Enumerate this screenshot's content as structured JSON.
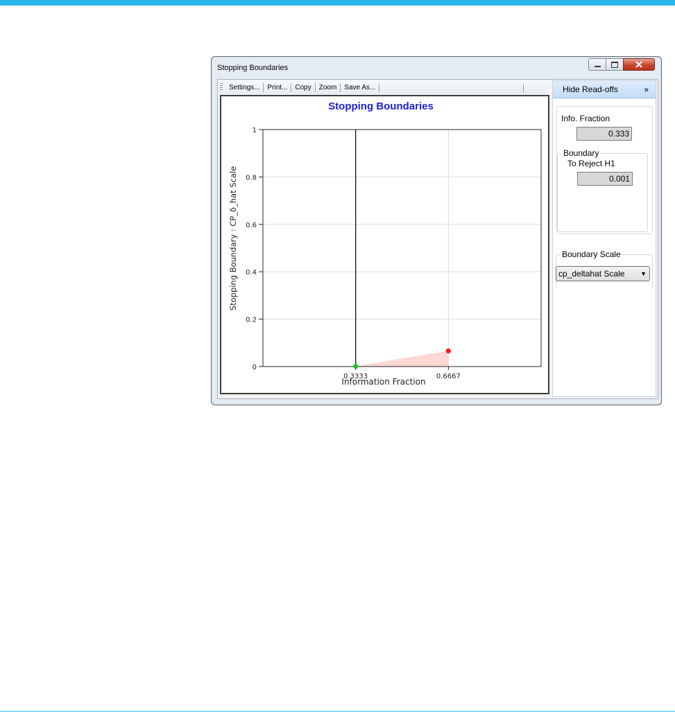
{
  "window": {
    "title": "Stopping Boundaries",
    "controls": {
      "minimize": "–",
      "maximize": "▫",
      "close": "✕"
    }
  },
  "toolbar": {
    "items": [
      "Settings...",
      "Print...",
      "Copy",
      "Zoom",
      "Save As..."
    ]
  },
  "readoffs": {
    "hide_label": "Hide Read-offs",
    "hide_chevron": "»",
    "info_fraction_label": "Info. Fraction",
    "info_fraction_value": "0.333",
    "boundary_group_label": "Boundary",
    "to_reject_label": "To Reject H1",
    "to_reject_value": "0.001",
    "boundary_scale_label": "Boundary Scale",
    "boundary_scale_selected": "cp_deltahat Scale"
  },
  "chart_data": {
    "type": "line",
    "title": "Stopping Boundaries",
    "xlabel": "Information Fraction",
    "ylabel": "Stopping Boundary : CP_δ_hat Scale",
    "xlim": [
      0,
      1
    ],
    "ylim": [
      0,
      1
    ],
    "x_ticks": [
      0.3333,
      0.6667
    ],
    "x_tick_labels": [
      "0.3333",
      "0.6667"
    ],
    "y_ticks": [
      0,
      0.2,
      0.4,
      0.6,
      0.8,
      1
    ],
    "y_tick_labels": [
      "0",
      "0.2",
      "0.4",
      "0.6",
      "0.8",
      "1"
    ],
    "grid": true,
    "current_info_fraction": 0.3333,
    "series": [
      {
        "x": [
          0.3333,
          0.6667
        ],
        "y": [
          0.001,
          0.066
        ],
        "point_colors": [
          "#22c422",
          "#ff1a1a"
        ],
        "fill_color": "#ffd7d2"
      }
    ],
    "title_color": "#1f1fd6"
  }
}
